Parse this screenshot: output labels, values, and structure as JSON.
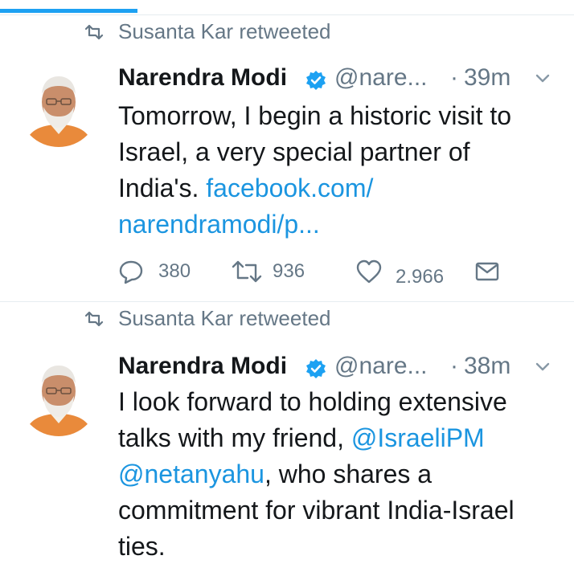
{
  "progress": {
    "fraction": 0.24,
    "color": "#1da1f2"
  },
  "tweets": [
    {
      "retweet_label": "Susanta Kar retweeted",
      "author": "Narendra Modi",
      "handle": "@nare...",
      "dot": "·",
      "time": "39m",
      "text_plain": "Tomorrow, I begin a historic visit to Israel, a very special partner of India's.",
      "link_1": "facebook.com/",
      "link_2": "narendramodi/p...",
      "replies": "380",
      "retweets": "936",
      "likes": "2.966",
      "icons": [
        "retweet-icon",
        "verified-icon",
        "chevron-down-icon",
        "reply-icon",
        "retweet-icon",
        "like-icon",
        "message-icon"
      ]
    },
    {
      "retweet_label": "Susanta Kar retweeted",
      "author": "Narendra Modi",
      "handle": "@nare...",
      "dot": "·",
      "time": "38m",
      "text_before": "I look forward to holding extensive talks with my friend, ",
      "mention_1": "@IsraeliPM",
      "mention_2": "@netanyahu",
      "text_after": ", who shares a commitment for vibrant India-Israel ties.",
      "icons": [
        "retweet-icon",
        "verified-icon",
        "chevron-down-icon"
      ]
    }
  ],
  "colors": {
    "accent": "#1da1f2",
    "link": "#1b95e0",
    "secondary_text": "#657786",
    "primary_text": "#14171a",
    "divider": "#e6ecf0"
  }
}
